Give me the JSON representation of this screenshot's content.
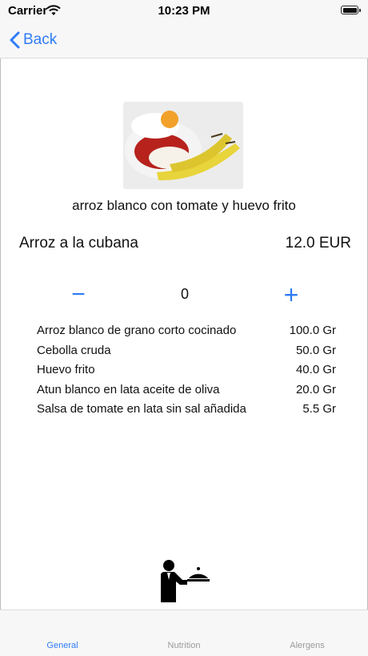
{
  "status_bar": {
    "carrier": "Carrier",
    "time": "10:23 PM"
  },
  "nav": {
    "back_label": "Back"
  },
  "dish": {
    "description": "arroz blanco con tomate y huevo frito",
    "name": "Arroz a la cubana",
    "price": "12.0 EUR"
  },
  "quantity": {
    "minus": "−",
    "value": "0",
    "plus": "+"
  },
  "ingredients": [
    {
      "name": "Arroz blanco de grano corto cocinado",
      "amount": "100.0 Gr"
    },
    {
      "name": "Cebolla cruda",
      "amount": "50.0 Gr"
    },
    {
      "name": "Huevo frito",
      "amount": "40.0 Gr"
    },
    {
      "name": "Atun blanco en lata aceite de oliva",
      "amount": "20.0 Gr"
    },
    {
      "name": "Salsa de tomate en lata sin sal añadida",
      "amount": "5.5 Gr"
    }
  ],
  "tabs": [
    {
      "label": "General",
      "active": true
    },
    {
      "label": "Nutrition",
      "active": false
    },
    {
      "label": "Alergens",
      "active": false
    }
  ],
  "colors": {
    "accent": "#2f7cf6",
    "bar_background": "#f7f7f7",
    "inactive_tab": "#9a9a9a"
  },
  "icons": [
    "wifi-icon",
    "battery-icon",
    "back-chevron-icon",
    "waiter-serving-icon"
  ]
}
